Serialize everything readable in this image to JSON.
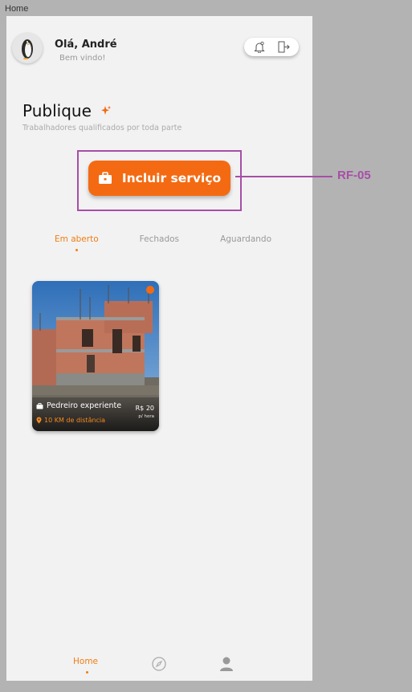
{
  "frame": {
    "label": "Home"
  },
  "header": {
    "greeting": "Olá, André",
    "welcome": "Bem vindo!"
  },
  "publish": {
    "title": "Publique",
    "subtitle": "Trabalhadores qualificados por toda parte",
    "button_label": "Incluir serviço"
  },
  "tabs": [
    {
      "label": "Em aberto",
      "active": true
    },
    {
      "label": "Fechados",
      "active": false
    },
    {
      "label": "Aguardando",
      "active": false
    }
  ],
  "card": {
    "title": "Pedreiro experiente",
    "distance": "10 KM de distância",
    "price": "R$ 20",
    "unit": "p/ hora"
  },
  "nav": {
    "home_label": "Home"
  },
  "annotation": {
    "label": "RF-05"
  },
  "colors": {
    "accent": "#f46a12",
    "annotation": "#a74ea7"
  }
}
